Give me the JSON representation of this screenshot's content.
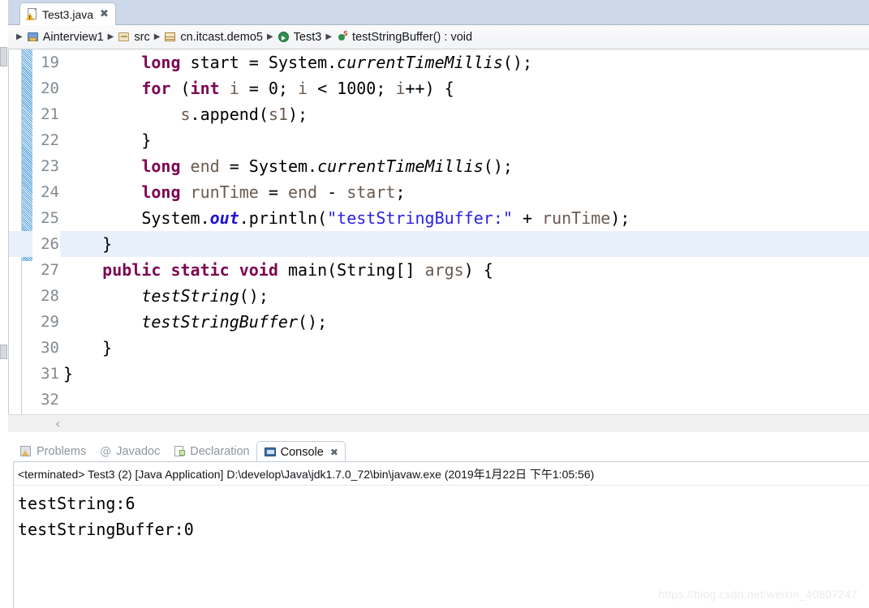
{
  "window": {
    "editor_tab": {
      "label": "Test3.java",
      "icon": "java-file-warning-icon",
      "close": "✖"
    }
  },
  "breadcrumb": {
    "separator": "▶",
    "items": [
      {
        "label": "Ainterview1",
        "icon": "java-project-icon"
      },
      {
        "label": "src",
        "icon": "source-folder-icon"
      },
      {
        "label": "cn.itcast.demo5",
        "icon": "package-icon"
      },
      {
        "label": "Test3",
        "icon": "class-icon"
      },
      {
        "label": "testStringBuffer() : void",
        "icon": "static-method-icon"
      }
    ]
  },
  "editor": {
    "first_visible_line": 19,
    "current_line": 26,
    "change_marker_lines": [
      19,
      26
    ],
    "scroll_left_arrow": "‹",
    "lines": [
      {
        "n": "19",
        "tokens": [
          {
            "t": "        ",
            "c": "plain"
          },
          {
            "t": "long",
            "c": "kw"
          },
          {
            "t": " start = System.",
            "c": "plain"
          },
          {
            "t": "currentTimeMillis",
            "c": "mth"
          },
          {
            "t": "();",
            "c": "plain"
          }
        ]
      },
      {
        "n": "20",
        "tokens": [
          {
            "t": "        ",
            "c": "plain"
          },
          {
            "t": "for",
            "c": "kw"
          },
          {
            "t": " (",
            "c": "plain"
          },
          {
            "t": "int",
            "c": "kw"
          },
          {
            "t": " ",
            "c": "plain"
          },
          {
            "t": "i",
            "c": "lvar"
          },
          {
            "t": " = 0; ",
            "c": "plain"
          },
          {
            "t": "i",
            "c": "lvar"
          },
          {
            "t": " < 1000; ",
            "c": "plain"
          },
          {
            "t": "i",
            "c": "lvar"
          },
          {
            "t": "++) {",
            "c": "plain"
          }
        ]
      },
      {
        "n": "21",
        "tokens": [
          {
            "t": "            ",
            "c": "plain"
          },
          {
            "t": "s",
            "c": "lvar"
          },
          {
            "t": ".append(",
            "c": "plain"
          },
          {
            "t": "s1",
            "c": "lvar"
          },
          {
            "t": ");",
            "c": "plain"
          }
        ]
      },
      {
        "n": "22",
        "tokens": [
          {
            "t": "        }",
            "c": "plain"
          }
        ]
      },
      {
        "n": "23",
        "tokens": [
          {
            "t": "        ",
            "c": "plain"
          },
          {
            "t": "long",
            "c": "kw"
          },
          {
            "t": " ",
            "c": "plain"
          },
          {
            "t": "end",
            "c": "lvar"
          },
          {
            "t": " = System.",
            "c": "plain"
          },
          {
            "t": "currentTimeMillis",
            "c": "mth"
          },
          {
            "t": "();",
            "c": "plain"
          }
        ]
      },
      {
        "n": "24",
        "tokens": [
          {
            "t": "        ",
            "c": "plain"
          },
          {
            "t": "long",
            "c": "kw"
          },
          {
            "t": " ",
            "c": "plain"
          },
          {
            "t": "runTime",
            "c": "lvar"
          },
          {
            "t": " = ",
            "c": "plain"
          },
          {
            "t": "end",
            "c": "lvar"
          },
          {
            "t": " - ",
            "c": "plain"
          },
          {
            "t": "start",
            "c": "lvar"
          },
          {
            "t": ";",
            "c": "plain"
          }
        ]
      },
      {
        "n": "25",
        "tokens": [
          {
            "t": "        System.",
            "c": "plain"
          },
          {
            "t": "out",
            "c": "fld"
          },
          {
            "t": ".println(",
            "c": "plain"
          },
          {
            "t": "\"testStringBuffer:\"",
            "c": "str"
          },
          {
            "t": " + ",
            "c": "plain"
          },
          {
            "t": "runTime",
            "c": "lvar"
          },
          {
            "t": ");",
            "c": "plain"
          }
        ]
      },
      {
        "n": "26",
        "tokens": [
          {
            "t": "    }",
            "c": "plain"
          }
        ]
      },
      {
        "n": "27",
        "tokens": [
          {
            "t": "    ",
            "c": "plain"
          },
          {
            "t": "public static void",
            "c": "kw"
          },
          {
            "t": " main(String[] ",
            "c": "plain"
          },
          {
            "t": "args",
            "c": "lvar"
          },
          {
            "t": ") {",
            "c": "plain"
          }
        ]
      },
      {
        "n": "28",
        "tokens": [
          {
            "t": "        ",
            "c": "plain"
          },
          {
            "t": "testString",
            "c": "mth"
          },
          {
            "t": "();",
            "c": "plain"
          }
        ]
      },
      {
        "n": "29",
        "tokens": [
          {
            "t": "        ",
            "c": "plain"
          },
          {
            "t": "testStringBuffer",
            "c": "mth"
          },
          {
            "t": "();",
            "c": "plain"
          }
        ]
      },
      {
        "n": "30",
        "tokens": [
          {
            "t": "    }",
            "c": "plain"
          }
        ]
      },
      {
        "n": "31",
        "tokens": [
          {
            "t": "}",
            "c": "plain"
          }
        ]
      },
      {
        "n": "32",
        "tokens": [
          {
            "t": "",
            "c": "plain"
          }
        ]
      }
    ]
  },
  "bottom_view": {
    "tabs": [
      {
        "label": "Problems",
        "icon": "problems-icon",
        "active": false,
        "closable": false
      },
      {
        "label": "Javadoc",
        "icon": "javadoc-at-icon",
        "active": false,
        "closable": false
      },
      {
        "label": "Declaration",
        "icon": "declaration-icon",
        "active": false,
        "closable": false
      },
      {
        "label": "Console",
        "icon": "console-icon",
        "active": true,
        "closable": true
      }
    ],
    "close_glyph": "✖"
  },
  "console": {
    "header": "<terminated> Test3 (2) [Java Application] D:\\develop\\Java\\jdk1.7.0_72\\bin\\javaw.exe (2019年1月22日 下午1:05:56)",
    "output_lines": [
      "testString:6",
      "testStringBuffer:0"
    ]
  },
  "watermark": {
    "text": "https://blog.csdn.net/weixin_40807247"
  },
  "colors": {
    "keyword": "#7d0552",
    "string": "#2a20e8",
    "static_field": "#1f14cf",
    "local_var": "#6a5b50",
    "current_line_bg": "#e8f0fb",
    "tabbar_bg": "#cdd9e9",
    "change_bar": "#6fb4e4"
  }
}
